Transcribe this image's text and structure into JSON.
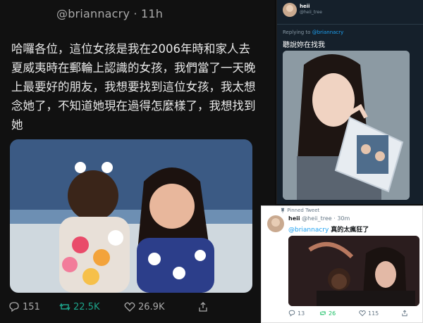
{
  "left_tweet": {
    "handle": "@briannacry · 11h",
    "text": "哈囉各位，這位女孩是我在2006年時和家人去夏威夷時在郵輪上認識的女孩，我們當了一天晚上最要好的朋友，我想要找到這位女孩，我太想念她了，不知道她現在過得怎麼樣了，我想找到她",
    "reply_count": "151",
    "retweet_count": "22.5K",
    "like_count": "26.9K"
  },
  "right_top_tweet": {
    "display_name": "heii",
    "handle": "@heii_tree",
    "replying_prefix": "Replying to",
    "replying_to": "@briannacry",
    "text": "聽說妳在找我"
  },
  "right_bottom_tweet": {
    "pinned_label": "Pinned Tweet",
    "display_name": "heii",
    "handle_time": "@heii_tree · 30m",
    "mention": "@briannacry",
    "text": "真的太瘋狂了",
    "reply_count": "13",
    "retweet_count": "26",
    "like_count": "115"
  },
  "colors": {
    "retweet_dark": "#1da38a",
    "retweet_light": "#17bf63",
    "link": "#1da1f2",
    "dark_bg": "#111111",
    "twitter_dark": "#15202b"
  },
  "icons": [
    "reply-icon",
    "retweet-icon",
    "like-icon",
    "share-icon",
    "pin-icon"
  ]
}
